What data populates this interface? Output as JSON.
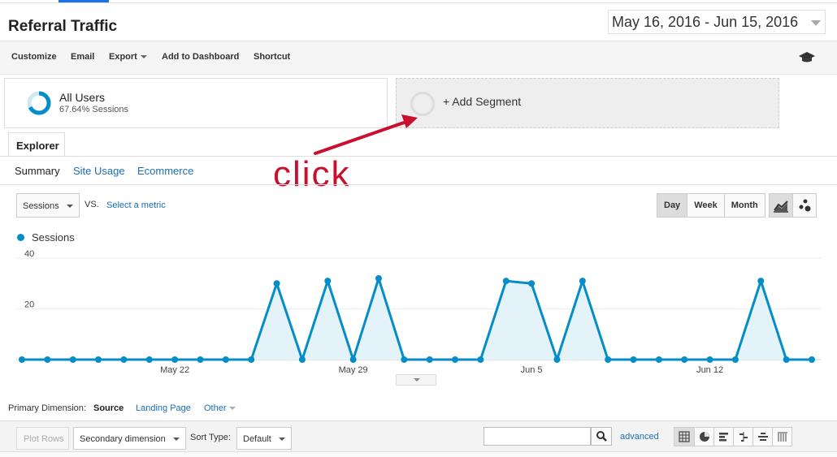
{
  "header": {
    "title": "Referral Traffic",
    "date_range": "May 16, 2016 - Jun 15, 2016"
  },
  "toolbar": {
    "items": [
      "Customize",
      "Email",
      "Export",
      "Add to Dashboard",
      "Shortcut"
    ]
  },
  "segments": {
    "active_name": "All Users",
    "active_sub": "67.64% Sessions",
    "add_label": "+ Add Segment"
  },
  "annotation": {
    "text": "click",
    "color": "#c8102e"
  },
  "tabs": {
    "explorer": "Explorer",
    "subtabs": [
      "Summary",
      "Site Usage",
      "Ecommerce"
    ]
  },
  "metric": {
    "selected": "Sessions",
    "vs": "VS.",
    "select_label": "Select a metric"
  },
  "range_buttons": [
    "Day",
    "Week",
    "Month"
  ],
  "legend": {
    "label": "Sessions",
    "color": "#058dc7"
  },
  "chart_data": {
    "type": "line",
    "series": [
      {
        "name": "Sessions",
        "values": [
          0,
          0,
          0,
          0,
          0,
          0,
          0,
          0,
          0,
          0,
          30,
          0,
          31,
          0,
          32,
          0,
          0,
          0,
          0,
          31,
          30,
          0,
          31,
          0,
          0,
          0,
          0,
          0,
          0,
          31,
          0,
          0
        ]
      }
    ],
    "ylim": [
      0,
      40
    ],
    "yticks": [
      20,
      40
    ],
    "xtick_labels": [
      "May 22",
      "May 29",
      "Jun 5",
      "Jun 12"
    ],
    "xtick_indices": [
      6,
      13,
      20,
      27
    ],
    "grid": true,
    "area_fill": true
  },
  "primary_dimension": {
    "label": "Primary Dimension:",
    "selected": "Source",
    "options": [
      "Landing Page",
      "Other"
    ]
  },
  "table_controls": {
    "plot_rows": "Plot Rows",
    "secondary_dimension": "Secondary dimension",
    "sort_type_label": "Sort Type:",
    "sort_type_value": "Default",
    "advanced": "advanced"
  }
}
